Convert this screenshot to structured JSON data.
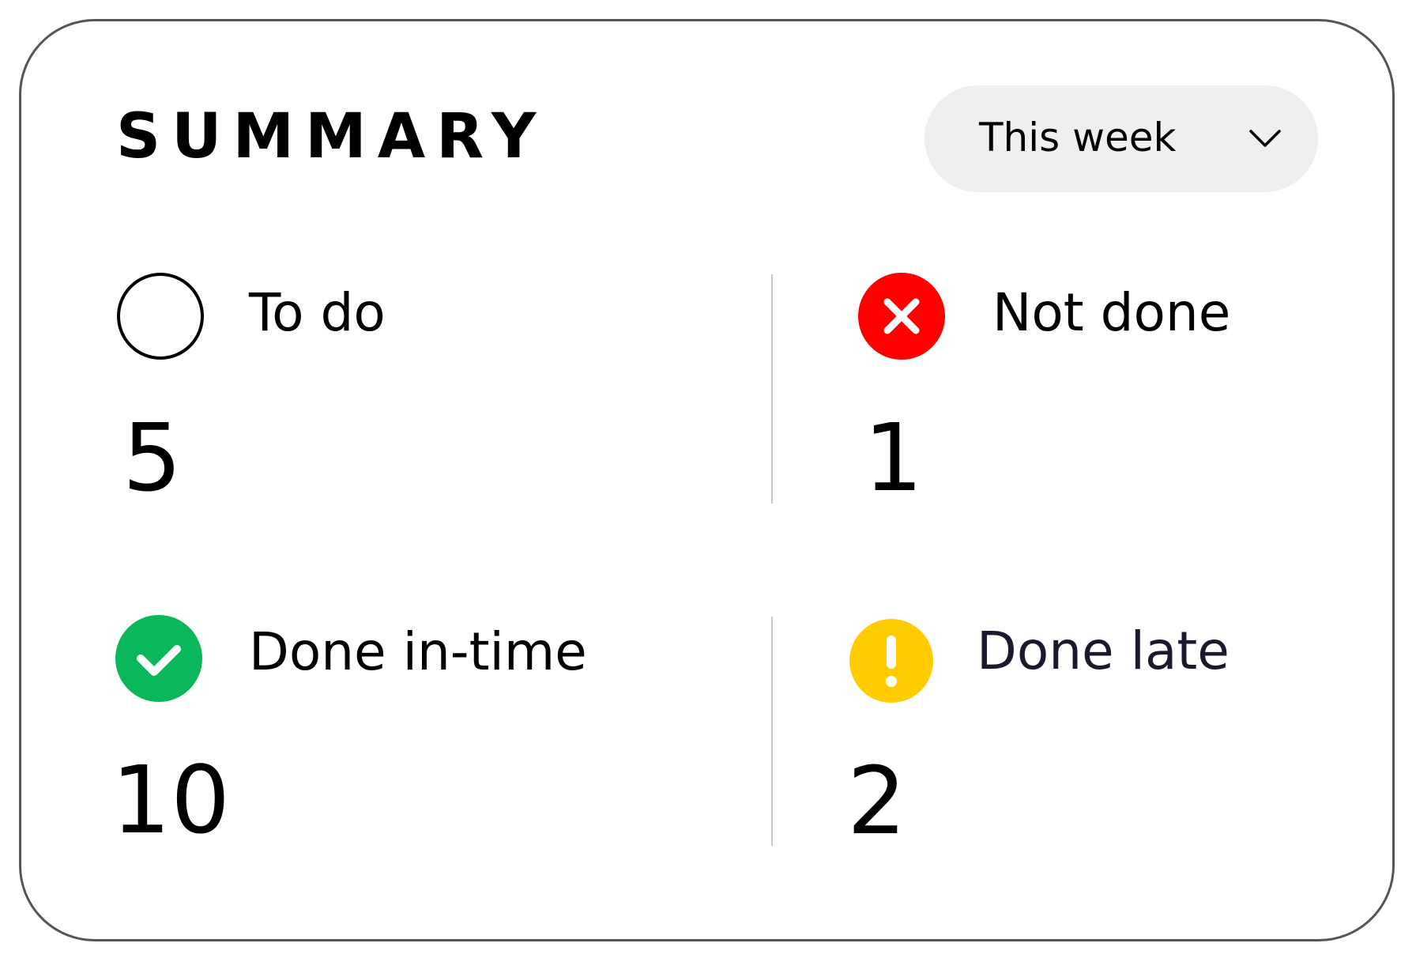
{
  "summary": {
    "title": "SUMMARY",
    "period": {
      "selected": "This week",
      "icon": "chevron-down-icon"
    }
  },
  "stats": {
    "todo": {
      "label": "To do",
      "value": "5",
      "icon": "empty-circle-icon",
      "color": "#000000"
    },
    "not_done": {
      "label": "Not done",
      "value": "1",
      "icon": "x-circle-icon",
      "color": "#ff0000"
    },
    "done_in_time": {
      "label": "Done in-time",
      "value": "10",
      "icon": "check-circle-icon",
      "color": "#0ab75a"
    },
    "done_late": {
      "label": "Done late",
      "value": "2",
      "icon": "exclamation-circle-icon",
      "color": "#ffcc00"
    }
  }
}
